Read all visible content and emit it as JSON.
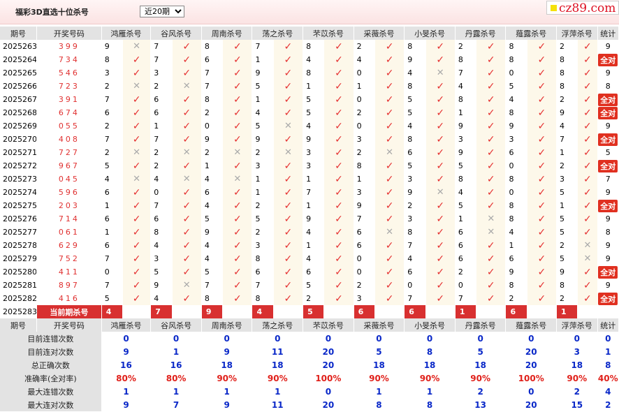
{
  "header": {
    "title": "福彩3D直选十位杀号",
    "period_selected": "近20期",
    "brand": "cz89.com"
  },
  "columns": [
    "期号",
    "开奖号码",
    "鸿雁杀号",
    "谷风杀号",
    "周南杀号",
    "荡之杀号",
    "芣苡杀号",
    "采薇杀号",
    "小旻杀号",
    "丹露杀号",
    "薤露杀号",
    "浮萍杀号",
    "统计"
  ],
  "rows": [
    {
      "issue": "2025263",
      "win": "399",
      "v": [
        "9",
        "7",
        "8",
        "7",
        "8",
        "2",
        "8",
        "2",
        "8",
        "2"
      ],
      "ok": [
        0,
        1,
        1,
        1,
        1,
        1,
        1,
        1,
        1,
        1
      ],
      "stat": "9"
    },
    {
      "issue": "2025264",
      "win": "734",
      "v": [
        "8",
        "7",
        "6",
        "1",
        "4",
        "4",
        "9",
        "8",
        "8",
        "8"
      ],
      "ok": [
        1,
        1,
        1,
        1,
        1,
        1,
        1,
        1,
        1,
        1
      ],
      "stat": "全对"
    },
    {
      "issue": "2025265",
      "win": "546",
      "v": [
        "3",
        "3",
        "7",
        "9",
        "8",
        "0",
        "4",
        "7",
        "0",
        "8"
      ],
      "ok": [
        1,
        1,
        1,
        1,
        1,
        1,
        0,
        1,
        1,
        1
      ],
      "stat": "9"
    },
    {
      "issue": "2025266",
      "win": "723",
      "v": [
        "2",
        "2",
        "7",
        "5",
        "1",
        "1",
        "8",
        "4",
        "5",
        "8"
      ],
      "ok": [
        0,
        0,
        1,
        1,
        1,
        1,
        1,
        1,
        1,
        1
      ],
      "stat": "8"
    },
    {
      "issue": "2025267",
      "win": "391",
      "v": [
        "7",
        "6",
        "8",
        "1",
        "5",
        "0",
        "5",
        "8",
        "4",
        "2"
      ],
      "ok": [
        1,
        1,
        1,
        1,
        1,
        1,
        1,
        1,
        1,
        1
      ],
      "stat": "全对"
    },
    {
      "issue": "2025268",
      "win": "674",
      "v": [
        "6",
        "6",
        "2",
        "4",
        "5",
        "2",
        "5",
        "1",
        "8",
        "9"
      ],
      "ok": [
        1,
        1,
        1,
        1,
        1,
        1,
        1,
        1,
        1,
        1
      ],
      "stat": "全对"
    },
    {
      "issue": "2025269",
      "win": "055",
      "v": [
        "2",
        "1",
        "0",
        "5",
        "4",
        "0",
        "4",
        "9",
        "9",
        "4"
      ],
      "ok": [
        1,
        1,
        1,
        0,
        1,
        1,
        1,
        1,
        1,
        1
      ],
      "stat": "9"
    },
    {
      "issue": "2025270",
      "win": "408",
      "v": [
        "7",
        "7",
        "9",
        "9",
        "9",
        "3",
        "8",
        "3",
        "3",
        "7"
      ],
      "ok": [
        1,
        1,
        1,
        1,
        1,
        1,
        1,
        1,
        1,
        1
      ],
      "stat": "全对"
    },
    {
      "issue": "2025271",
      "win": "727",
      "v": [
        "2",
        "2",
        "2",
        "2",
        "3",
        "2",
        "6",
        "9",
        "6",
        "1"
      ],
      "ok": [
        0,
        0,
        0,
        0,
        1,
        0,
        1,
        1,
        1,
        1
      ],
      "stat": "5"
    },
    {
      "issue": "2025272",
      "win": "967",
      "v": [
        "5",
        "2",
        "1",
        "3",
        "3",
        "8",
        "5",
        "5",
        "0",
        "2"
      ],
      "ok": [
        1,
        1,
        1,
        1,
        1,
        1,
        1,
        1,
        1,
        1
      ],
      "stat": "全对"
    },
    {
      "issue": "2025273",
      "win": "045",
      "v": [
        "4",
        "4",
        "4",
        "1",
        "1",
        "1",
        "3",
        "8",
        "8",
        "3"
      ],
      "ok": [
        0,
        0,
        0,
        1,
        1,
        1,
        1,
        1,
        1,
        1
      ],
      "stat": "7"
    },
    {
      "issue": "2025274",
      "win": "596",
      "v": [
        "6",
        "0",
        "6",
        "1",
        "7",
        "3",
        "9",
        "4",
        "0",
        "5"
      ],
      "ok": [
        1,
        1,
        1,
        1,
        1,
        1,
        0,
        1,
        1,
        1
      ],
      "stat": "9"
    },
    {
      "issue": "2025275",
      "win": "203",
      "v": [
        "1",
        "7",
        "4",
        "2",
        "1",
        "9",
        "2",
        "5",
        "8",
        "1"
      ],
      "ok": [
        1,
        1,
        1,
        1,
        1,
        1,
        1,
        1,
        1,
        1
      ],
      "stat": "全对"
    },
    {
      "issue": "2025276",
      "win": "714",
      "v": [
        "6",
        "6",
        "5",
        "5",
        "9",
        "7",
        "3",
        "1",
        "8",
        "5"
      ],
      "ok": [
        1,
        1,
        1,
        1,
        1,
        1,
        1,
        0,
        1,
        1
      ],
      "stat": "9"
    },
    {
      "issue": "2025277",
      "win": "061",
      "v": [
        "1",
        "8",
        "9",
        "2",
        "4",
        "6",
        "8",
        "6",
        "4",
        "5"
      ],
      "ok": [
        1,
        1,
        1,
        1,
        1,
        0,
        1,
        0,
        1,
        1
      ],
      "stat": "8"
    },
    {
      "issue": "2025278",
      "win": "629",
      "v": [
        "6",
        "4",
        "4",
        "3",
        "1",
        "6",
        "7",
        "6",
        "1",
        "2"
      ],
      "ok": [
        1,
        1,
        1,
        1,
        1,
        1,
        1,
        1,
        1,
        0
      ],
      "stat": "9"
    },
    {
      "issue": "2025279",
      "win": "752",
      "v": [
        "7",
        "3",
        "4",
        "8",
        "4",
        "0",
        "4",
        "6",
        "6",
        "5"
      ],
      "ok": [
        1,
        1,
        1,
        1,
        1,
        1,
        1,
        1,
        1,
        0
      ],
      "stat": "9"
    },
    {
      "issue": "2025280",
      "win": "411",
      "v": [
        "0",
        "5",
        "5",
        "6",
        "6",
        "0",
        "6",
        "2",
        "9",
        "9"
      ],
      "ok": [
        1,
        1,
        1,
        1,
        1,
        1,
        1,
        1,
        1,
        1
      ],
      "stat": "全对"
    },
    {
      "issue": "2025281",
      "win": "897",
      "v": [
        "7",
        "9",
        "7",
        "7",
        "5",
        "2",
        "0",
        "0",
        "8",
        "8"
      ],
      "ok": [
        1,
        0,
        1,
        1,
        1,
        1,
        1,
        1,
        1,
        1
      ],
      "stat": "9"
    },
    {
      "issue": "2025282",
      "win": "416",
      "v": [
        "5",
        "4",
        "8",
        "8",
        "2",
        "3",
        "7",
        "7",
        "2",
        "2"
      ],
      "ok": [
        1,
        1,
        1,
        1,
        1,
        1,
        1,
        1,
        1,
        1
      ],
      "stat": "全对"
    }
  ],
  "current": {
    "issue": "2025283",
    "label": "当前期杀号",
    "v": [
      "4",
      "7",
      "9",
      "4",
      "5",
      "6",
      "6",
      "1",
      "6",
      "1"
    ]
  },
  "summary_header": [
    "期号",
    "开奖号码",
    "鸿雁杀号",
    "谷风杀号",
    "周南杀号",
    "荡之杀号",
    "芣苡杀号",
    "采薇杀号",
    "小旻杀号",
    "丹露杀号",
    "薤露杀号",
    "浮萍杀号",
    "统计"
  ],
  "summary": [
    {
      "label": "目前连错次数",
      "v": [
        "0",
        "0",
        "0",
        "0",
        "0",
        "0",
        "0",
        "0",
        "0",
        "0",
        "0"
      ]
    },
    {
      "label": "目前连对次数",
      "v": [
        "9",
        "1",
        "9",
        "11",
        "20",
        "5",
        "8",
        "5",
        "20",
        "3",
        "1"
      ]
    },
    {
      "label": "总正确次数",
      "v": [
        "16",
        "16",
        "18",
        "18",
        "20",
        "18",
        "18",
        "18",
        "20",
        "18",
        "8"
      ]
    },
    {
      "label": "准确率(全对率)",
      "v": [
        "80%",
        "80%",
        "90%",
        "90%",
        "100%",
        "90%",
        "90%",
        "90%",
        "100%",
        "90%",
        "40%"
      ],
      "red": true
    },
    {
      "label": "最大连错次数",
      "v": [
        "1",
        "1",
        "1",
        "1",
        "0",
        "1",
        "1",
        "2",
        "0",
        "2",
        "4"
      ]
    },
    {
      "label": "最大连对次数",
      "v": [
        "9",
        "7",
        "9",
        "11",
        "20",
        "8",
        "8",
        "13",
        "20",
        "15",
        "2"
      ]
    }
  ],
  "icons": {
    "correct": "check-icon",
    "wrong": "cross-icon"
  },
  "colors": {
    "accent": "#e03030",
    "blue": "#0a28c8",
    "cell_bg": "#fdf8ea"
  }
}
